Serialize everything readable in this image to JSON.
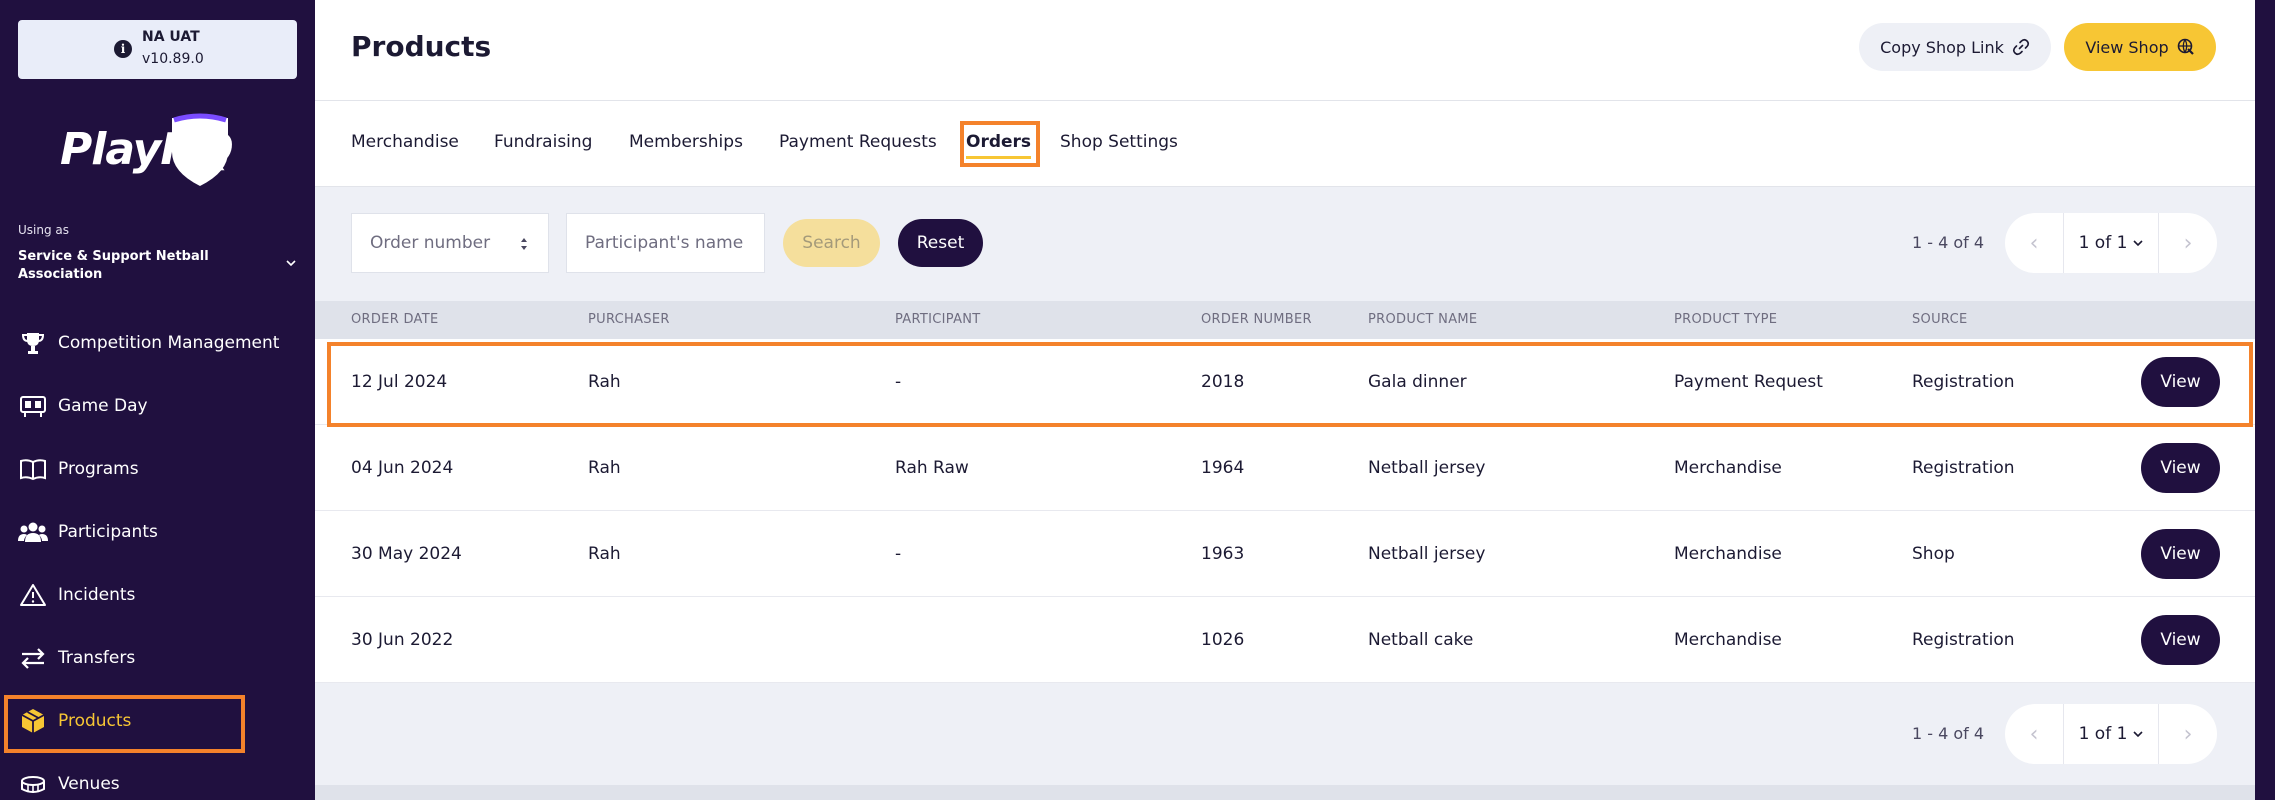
{
  "sidebar": {
    "env": {
      "name": "NA UAT",
      "version": "v10.89.0"
    },
    "logo_text": "PlayHQ",
    "using_as_label": "Using as",
    "org_name": "Service & Support Netball Association",
    "items": [
      {
        "label": "Competition Management",
        "icon": "trophy-icon"
      },
      {
        "label": "Game Day",
        "icon": "scoreboard-icon"
      },
      {
        "label": "Programs",
        "icon": "book-icon"
      },
      {
        "label": "Participants",
        "icon": "people-icon"
      },
      {
        "label": "Incidents",
        "icon": "warning-icon"
      },
      {
        "label": "Transfers",
        "icon": "arrows-icon"
      },
      {
        "label": "Products",
        "icon": "box-icon",
        "active": true
      },
      {
        "label": "Venues",
        "icon": "stadium-icon"
      }
    ]
  },
  "header": {
    "title": "Products",
    "copy_link_label": "Copy Shop Link",
    "view_shop_label": "View Shop"
  },
  "tabs": [
    {
      "label": "Merchandise"
    },
    {
      "label": "Fundraising"
    },
    {
      "label": "Memberships"
    },
    {
      "label": "Payment Requests"
    },
    {
      "label": "Orders",
      "active": true
    },
    {
      "label": "Shop Settings"
    }
  ],
  "filters": {
    "order_number_placeholder": "Order number",
    "participant_placeholder": "Participant's name",
    "search_label": "Search",
    "reset_label": "Reset"
  },
  "pagination": {
    "range": "1 - 4 of 4",
    "page": "1 of 1"
  },
  "table": {
    "columns": [
      "ORDER DATE",
      "PURCHASER",
      "PARTICIPANT",
      "ORDER NUMBER",
      "PRODUCT NAME",
      "PRODUCT TYPE",
      "SOURCE"
    ],
    "view_label": "View",
    "rows": [
      {
        "date": "12 Jul 2024",
        "purchaser": "Rah",
        "participant": "-",
        "order_number": "2018",
        "product": "Gala dinner",
        "type": "Payment Request",
        "source": "Registration"
      },
      {
        "date": "04 Jun 2024",
        "purchaser": "Rah",
        "participant": "Rah Raw",
        "order_number": "1964",
        "product": "Netball jersey",
        "type": "Merchandise",
        "source": "Registration"
      },
      {
        "date": "30 May 2024",
        "purchaser": "Rah",
        "participant": "-",
        "order_number": "1963",
        "product": "Netball jersey",
        "type": "Merchandise",
        "source": "Shop"
      },
      {
        "date": "30 Jun 2022",
        "purchaser": "",
        "participant": "",
        "order_number": "1026",
        "product": "Netball cake",
        "type": "Merchandise",
        "source": "Registration"
      }
    ]
  },
  "colors": {
    "sidebar_bg": "#20103f",
    "accent_yellow": "#f7c634",
    "highlight_orange": "#f4822b"
  }
}
